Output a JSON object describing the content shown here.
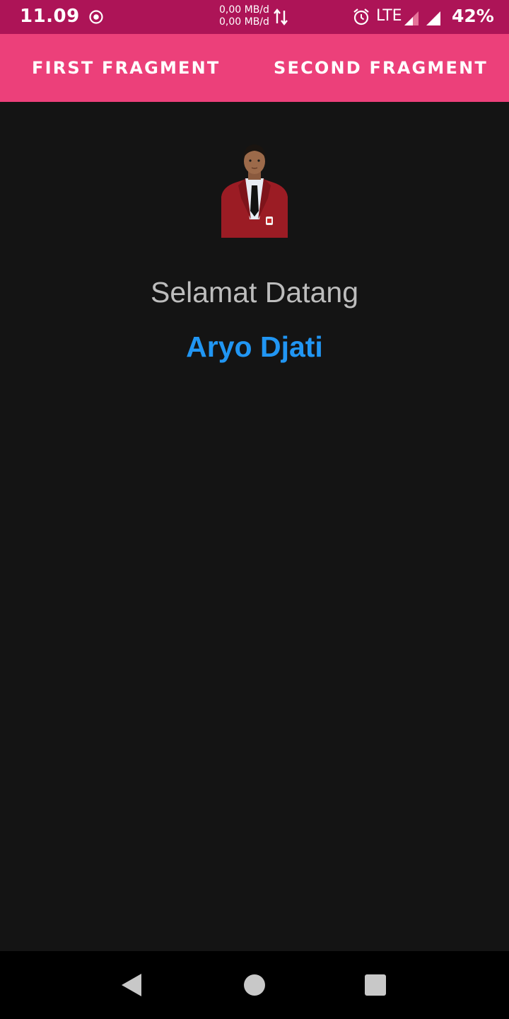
{
  "status_bar": {
    "time": "11.09",
    "record_icon": "record-circle-icon",
    "data_up": "0,00 MB/d",
    "data_down": "0,00 MB/d",
    "data_icon": "up-down-arrows-icon",
    "alarm_icon": "alarm-clock-icon",
    "network": "LTE",
    "signal_icon": "signal-icon",
    "battery": "42%"
  },
  "tabs": [
    {
      "label": "FIRST FRAGMENT"
    },
    {
      "label": "SECOND FRAGMENT"
    }
  ],
  "content": {
    "photo_icon": "profile-photo",
    "welcome": "Selamat Datang",
    "name": "Aryo Djati"
  },
  "nav": {
    "back_icon": "back-triangle-icon",
    "home_icon": "home-circle-icon",
    "recents_icon": "recents-square-icon"
  },
  "colors": {
    "status_bar": "#AD1457",
    "tab_bar": "#EC407A",
    "background": "#141414",
    "welcome_text": "#BDBDBD",
    "name_text": "#2196F3"
  }
}
